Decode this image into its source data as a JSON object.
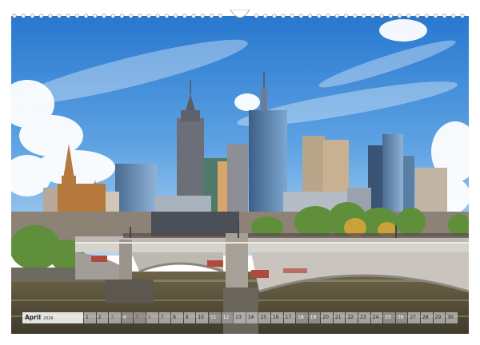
{
  "calendar": {
    "month": "April",
    "year": "2026",
    "days": [
      {
        "n": "1",
        "weekend": false,
        "holiday": false
      },
      {
        "n": "2",
        "weekend": false,
        "holiday": false
      },
      {
        "n": "3",
        "weekend": false,
        "holiday": true
      },
      {
        "n": "4",
        "weekend": true,
        "holiday": false
      },
      {
        "n": "5",
        "weekend": true,
        "holiday": true
      },
      {
        "n": "6",
        "weekend": false,
        "holiday": true
      },
      {
        "n": "7",
        "weekend": false,
        "holiday": false
      },
      {
        "n": "8",
        "weekend": false,
        "holiday": false
      },
      {
        "n": "9",
        "weekend": false,
        "holiday": false
      },
      {
        "n": "10",
        "weekend": false,
        "holiday": false
      },
      {
        "n": "11",
        "weekend": true,
        "holiday": false
      },
      {
        "n": "12",
        "weekend": true,
        "holiday": false
      },
      {
        "n": "13",
        "weekend": false,
        "holiday": false
      },
      {
        "n": "14",
        "weekend": false,
        "holiday": false
      },
      {
        "n": "15",
        "weekend": false,
        "holiday": false
      },
      {
        "n": "16",
        "weekend": false,
        "holiday": false
      },
      {
        "n": "17",
        "weekend": false,
        "holiday": false
      },
      {
        "n": "18",
        "weekend": true,
        "holiday": false
      },
      {
        "n": "19",
        "weekend": true,
        "holiday": false
      },
      {
        "n": "20",
        "weekend": false,
        "holiday": false
      },
      {
        "n": "21",
        "weekend": false,
        "holiday": false
      },
      {
        "n": "22",
        "weekend": false,
        "holiday": false
      },
      {
        "n": "23",
        "weekend": false,
        "holiday": false
      },
      {
        "n": "24",
        "weekend": false,
        "holiday": false
      },
      {
        "n": "25",
        "weekend": true,
        "holiday": false
      },
      {
        "n": "26",
        "weekend": true,
        "holiday": false
      },
      {
        "n": "27",
        "weekend": false,
        "holiday": false
      },
      {
        "n": "28",
        "weekend": false,
        "holiday": false
      },
      {
        "n": "29",
        "weekend": false,
        "holiday": false
      },
      {
        "n": "30",
        "weekend": false,
        "holiday": false
      }
    ]
  },
  "colors": {
    "sky_top": "#2f7fd1",
    "sky_bottom": "#a9d1f2",
    "river": "#7a6a46",
    "bridge": "#c9c5bf",
    "trees": "#5f8f3a",
    "holiday_text": "#c0392b"
  },
  "photo_subject": "city-skyline-with-bridge-and-river"
}
